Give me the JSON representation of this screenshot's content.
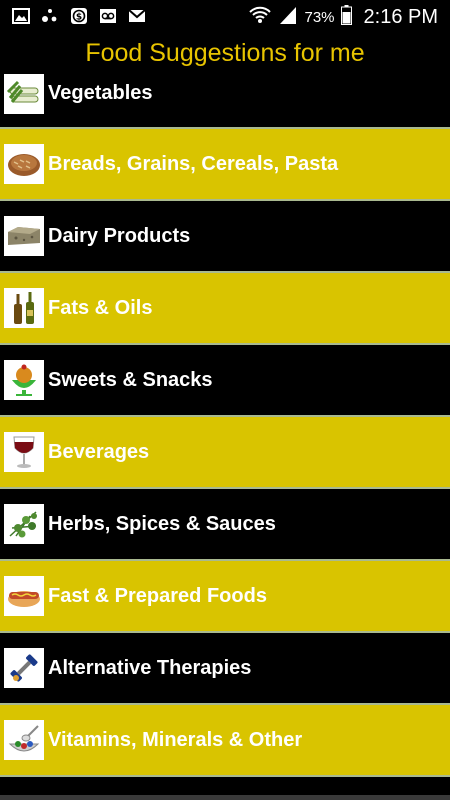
{
  "status_bar": {
    "icons": [
      "gallery-icon",
      "dots-icon",
      "money-icon",
      "voicemail-icon",
      "gmail-icon"
    ],
    "battery_percent": "73%",
    "time": "2:16 PM"
  },
  "title": "Food Suggestions for me",
  "colors": {
    "accent": "#e8c400",
    "row_yellow": "#d9c400",
    "row_dark": "#000000",
    "divider": "#a9b98f"
  },
  "categories": [
    {
      "label": "Vegetables",
      "icon": "vegetables-icon"
    },
    {
      "label": "Breads, Grains, Cereals, Pasta",
      "icon": "bread-icon"
    },
    {
      "label": "Dairy Products",
      "icon": "dairy-icon"
    },
    {
      "label": "Fats & Oils",
      "icon": "oil-bottles-icon"
    },
    {
      "label": "Sweets & Snacks",
      "icon": "dessert-icon"
    },
    {
      "label": "Beverages",
      "icon": "wine-glass-icon"
    },
    {
      "label": "Herbs, Spices & Sauces",
      "icon": "herbs-icon"
    },
    {
      "label": "Fast & Prepared Foods",
      "icon": "hotdog-icon"
    },
    {
      "label": "Alternative Therapies",
      "icon": "dumbbell-icon"
    },
    {
      "label": "Vitamins, Minerals & Other",
      "icon": "vitamins-icon"
    }
  ]
}
